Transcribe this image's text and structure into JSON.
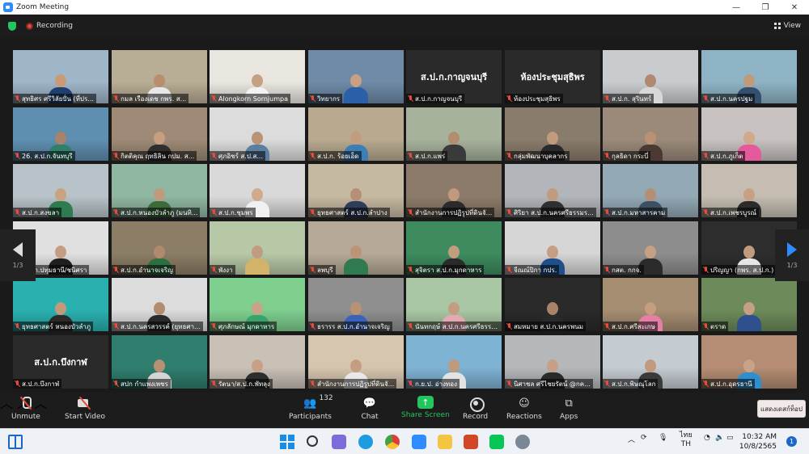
{
  "window": {
    "title": "Zoom Meeting",
    "minimize": "—",
    "maximize": "❐",
    "close": "✕"
  },
  "meeting": {
    "recording_label": "Recording",
    "view_label": "View",
    "page_indicator_left": "1/3",
    "page_indicator_right": "1/3"
  },
  "tiles": [
    {
      "name": "สุทธิศร ศรีวิลัยปั่น (ที่ปร...",
      "skin": "#c99a78",
      "shirt": "#1f3f6e",
      "bg": "#9fb5c8"
    },
    {
      "name": "กมล เรืองเดช กพร. ส...",
      "skin": "#b98d6e",
      "shirt": "#e8e8e8",
      "bg": "#b8ad95"
    },
    {
      "name": "Alongkorn Sornjumpa",
      "skin": "#c4a084",
      "shirt": "#f2f2f2",
      "bg": "#e9e6e0"
    },
    {
      "name": "วิทยากร",
      "skin": "#c9a182",
      "shirt": "#2b5fa8",
      "bg": "#6f8ba8"
    },
    {
      "name": "ส.ป.ก.กาญจนบุรี",
      "big": "ส.ป.ก.กาญจนบุรี",
      "bg": "#2a2a2a"
    },
    {
      "name": "ห้องประชุมสุธิพร",
      "big": "ห้องประชุมสุธิพร",
      "bg": "#2a2a2a",
      "active": true
    },
    {
      "name": "ส.ป.ก. สุรินทร์",
      "skin": "#b08a70",
      "shirt": "#d8d8d8",
      "bg": "#c9cccf"
    },
    {
      "name": "ส.ป.ก.นครปฐม",
      "skin": "#c19a7c",
      "shirt": "#35506f",
      "bg": "#8eb3c4"
    },
    {
      "name": "26. ส.ป.ก.จันทบุรี",
      "skin": "#a9826a",
      "shirt": "#2f7f6a",
      "bg": "#5f8fb0"
    },
    {
      "name": "กิตติคุณ ฤทธิลิน กปม. ส...",
      "skin": "#c79e80",
      "shirt": "#2e2e2e",
      "bg": "#9e8a76"
    },
    {
      "name": "ศุภอิชร์ ส.ป.ส...",
      "skin": "#b99376",
      "shirt": "#5b7fa0",
      "bg": "#dcdcdc"
    },
    {
      "name": "ส.ป.ก. ร้อยเอ็ด",
      "skin": "#c39c80",
      "shirt": "#3b7fb5",
      "bg": "#b9aa8f"
    },
    {
      "name": "ส.ป.ก.แพร่",
      "skin": "#b38d70",
      "shirt": "#3a3a3a",
      "bg": "#a7b29d"
    },
    {
      "name": "กลุ่มพัฒนาบุคลากร",
      "skin": "#c29b7e",
      "shirt": "#2a2a2a",
      "bg": "#8a7c6c"
    },
    {
      "name": "กุลธิดา กระบี่",
      "skin": "#b99275",
      "shirt": "#4a3a33",
      "bg": "#9b8a7a"
    },
    {
      "name": "ส.ป.ก.ภูเก็ต",
      "skin": "#d0a88a",
      "shirt": "#e45a9a",
      "bg": "#c7c2c0"
    },
    {
      "name": "ส.ป.ก.สงขลา",
      "skin": "#c8a283",
      "shirt": "#2d7b4f",
      "bg": "#b7c3c9"
    },
    {
      "name": "ส.ป.ก.หนองบัวลำภู (มนทิ...",
      "skin": "#c09a7c",
      "shirt": "#3c6a3a",
      "bg": "#8fb7a2"
    },
    {
      "name": "ส.ป.ก.ชุมพร",
      "skin": "#d0aa8d",
      "shirt": "#f0f0f0",
      "bg": "#d9d9d9"
    },
    {
      "name": "ยุทธศาสตร์ ส.ป.ก.ลำปาง",
      "skin": "#b69074",
      "shirt": "#2f3d5a",
      "bg": "#c6b9a2"
    },
    {
      "name": "สำนักงานการปฏิรูปที่ดินจั...",
      "skin": "#c19a7e",
      "shirt": "#2b2b2b",
      "bg": "#8c7b6a"
    },
    {
      "name": "ศิริยา ส.ป.ก.นครศรีธรรมร...",
      "skin": "#c09b7e",
      "shirt": "#2f2f2f",
      "bg": "#b2b5ba"
    },
    {
      "name": "ส.ป.ก.มหาสารคาม",
      "skin": "#b58f73",
      "shirt": "#3d4f63",
      "bg": "#93a9b5"
    },
    {
      "name": "ส.ป.ก.เพชรบูรณ์",
      "skin": "#c8a086",
      "shirt": "#2b2b2b",
      "bg": "#c5bdb2"
    },
    {
      "name": "ส.ป.ก.ปทุมธานี/ชนิศรา",
      "skin": "#c49e82",
      "shirt": "#1f1f1f",
      "bg": "#e0e0e0"
    },
    {
      "name": "ส.ป.ก.อำนาจเจริญ",
      "skin": "#b08a6e",
      "shirt": "#2d6e3e",
      "bg": "#8c7e66"
    },
    {
      "name": "พังงา",
      "skin": "#c19b80",
      "shirt": "#d3b26a",
      "bg": "#b7c8a6"
    },
    {
      "name": "ลพบุรี",
      "skin": "#bb9478",
      "shirt": "#2f7a50",
      "bg": "#b6a997"
    },
    {
      "name": "สุจิตรา ส.ป.ก.มุกดาหาร",
      "skin": "#c29c7f",
      "shirt": "#2a2a2a",
      "bg": "#3e8b5f"
    },
    {
      "name": "จีณณ์ปิกา กปร.",
      "skin": "#c59f84",
      "shirt": "#1f4e8a",
      "bg": "#d6d6d6"
    },
    {
      "name": "กสต. กกจ.",
      "skin": "#c7a084",
      "shirt": "#2b2b2b",
      "bg": "#8d8d8d"
    },
    {
      "name": "ปริญญา (กพร. ส.ป.ก.)",
      "skin": "#c29b7d",
      "shirt": "#e6e6e6",
      "bg": "#2d2d2d"
    },
    {
      "name": "ยุทธศาสตร์ หนองบัวลำภู",
      "skin": "#c19a7c",
      "shirt": "#2a2a2a",
      "bg": "#2bb0b0"
    },
    {
      "name": "ส.ป.ก.นครสวรรค์ (ยุทธศา...",
      "skin": "#b38c70",
      "shirt": "#2a2a2a",
      "bg": "#dcdcdc"
    },
    {
      "name": "ศุภลักษณ์ มุกดาหาร",
      "skin": "#c9a387",
      "shirt": "#3aa36c",
      "bg": "#7fcf8f"
    },
    {
      "name": "ธรารร ส.ป.ก.อำนาจเจริญ",
      "skin": "#b99274",
      "shirt": "#3a63b8",
      "bg": "#8f8f8f"
    },
    {
      "name": "นันทกฤษ์ ส.ป.ก.นครศรีธรรมร...",
      "skin": "#c39d81",
      "shirt": "#e5a9b4",
      "bg": "#a9c7a4"
    },
    {
      "name": "สมหมาย ส.ป.ก.นครพนม",
      "skin": "#a98369",
      "shirt": "#2a2a2a",
      "bg": "#2a2a2a"
    },
    {
      "name": "ส.ป.ก.ศรีสะเกษ",
      "skin": "#c49c80",
      "shirt": "#e67fa6",
      "bg": "#a68e72"
    },
    {
      "name": "ตราด",
      "skin": "#c6a085",
      "shirt": "#2f4f8f",
      "bg": "#6d8b5a"
    },
    {
      "name": "ส.ป.ก.บึงกาฬ",
      "big": "ส.ป.ก.บึงกาฬ",
      "bg": "#2a2a2a"
    },
    {
      "name": "สปก กำแพงเพชร",
      "skin": "#b89175",
      "shirt": "#d5d5d5",
      "bg": "#2f7e6e"
    },
    {
      "name": "รัตนา/ส.ป.ก.พัทลุง",
      "skin": "#c7a185",
      "shirt": "#2d2d2d",
      "bg": "#c9c1b6"
    },
    {
      "name": "สำนักงานการปฏิรูปที่ดินจั...",
      "skin": "#c49e81",
      "shirt": "#e8e8e8",
      "bg": "#d6c6b0"
    },
    {
      "name": "ก.ย.ป. อ่างทอง",
      "skin": "#c19a7d",
      "shirt": "#e3e3e3",
      "bg": "#7fb3d4"
    },
    {
      "name": "นิศาชล ศรีไชยรัตน์ @กค...",
      "skin": "#c6a086",
      "shirt": "#2a2a2a",
      "bg": "#b5b8bb"
    },
    {
      "name": "ส.ป.ก.พิษณุโลก",
      "skin": "#c29a7e",
      "shirt": "#3b3b3b",
      "bg": "#c4cbd1"
    },
    {
      "name": "ส.ป.ก.อุดรธานี",
      "skin": "#c8a286",
      "shirt": "#2e8fd0",
      "bg": "#b58d74"
    }
  ],
  "controls": {
    "unmute": "Unmute",
    "start_video": "Start Video",
    "participants": "Participants",
    "participants_count": "132",
    "chat": "Chat",
    "share_screen": "Share Screen",
    "record": "Record",
    "reactions": "Reactions",
    "apps": "Apps",
    "show_desktop": "แสดงเดสก์ท็อป"
  },
  "taskbar": {
    "language": "ไทย",
    "language_code": "TH",
    "time": "10:32 AM",
    "date": "10/8/2565",
    "notifications": "1"
  }
}
